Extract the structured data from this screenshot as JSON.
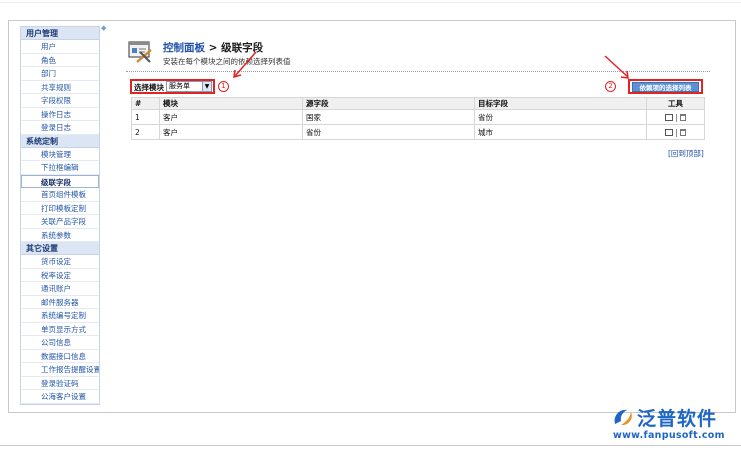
{
  "sidebar": {
    "groups": [
      {
        "title": "用户管理",
        "items": [
          "用户",
          "角色",
          "部门",
          "共享规则",
          "字段权限",
          "操作日志",
          "登录日志"
        ]
      },
      {
        "title": "系统定制",
        "items": [
          "模块管理",
          "下拉框编辑",
          "级联字段",
          "首页组件模板",
          "打印模板定制",
          "关联产品字段",
          "系统参数"
        ]
      },
      {
        "title": "其它设置",
        "items": [
          "货币设定",
          "税率设定",
          "通讯账户",
          "邮件服务器",
          "系统编号定制",
          "单页显示方式",
          "公司信息",
          "数据接口信息",
          "工作报告提醒设置",
          "登录验证码",
          "公海客户设置"
        ]
      }
    ],
    "active_item": "级联字段"
  },
  "header": {
    "crumb": "控制面板",
    "separator": ">",
    "title": "级联字段",
    "subtitle": "安装在每个模块之间的依赖选择列表值"
  },
  "toolbar": {
    "module_label": "选择模块",
    "module_value": "服务单",
    "dependency_button": "依赖项的选择列表",
    "badge_1": "1",
    "badge_2": "2"
  },
  "table": {
    "headers": [
      "#",
      "模块",
      "源字段",
      "目标字段",
      "工具"
    ],
    "rows": [
      [
        "1",
        "客户",
        "国家",
        "省份"
      ],
      [
        "2",
        "客户",
        "省份",
        "城市"
      ]
    ]
  },
  "back_link": "[回到顶部]",
  "logo": {
    "name": "泛普软件",
    "url": "www.fanpusoft.com"
  },
  "colors": {
    "annotation_red": "#e02424",
    "link_blue": "#2050a8",
    "button_blue": "#5d91d0",
    "brand_blue": "#1e66c4"
  }
}
